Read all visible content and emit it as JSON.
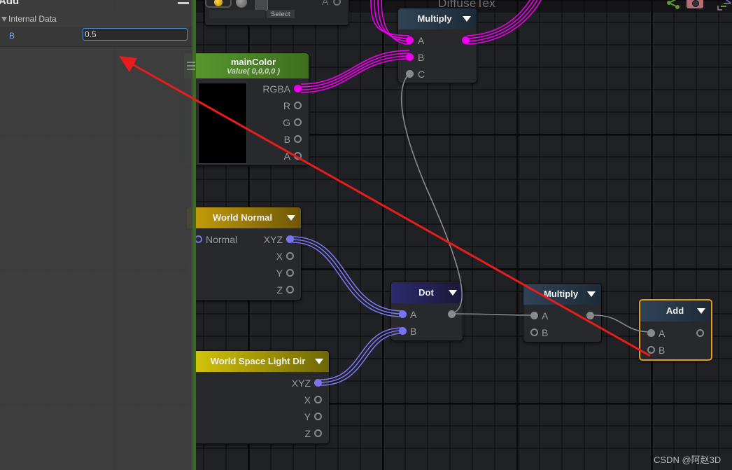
{
  "graph": {
    "title": "DiffuseTex",
    "watermark": "CSDN @阿赵3D",
    "toolbar_icons": [
      "share-icon",
      "camera-icon",
      "graph-layout-icon"
    ]
  },
  "colors": {
    "canvas_bg": "#202124",
    "wire_color": "#ee00ee",
    "wire_vector": "#7b74f0",
    "wire_float": "#8a8a8c",
    "selection": "#e09b1e",
    "annotation_arrow": "#e81c1c",
    "panel_accent": "#3a6b21"
  },
  "panel": {
    "title": "Add",
    "section": "Internal Data",
    "property_label": "B",
    "property_value": "0.5"
  },
  "top_partial_node": {
    "select_label": "Select",
    "port_label": "A"
  },
  "nodes": {
    "multiply_top": {
      "title": "Multiply",
      "inputs": [
        "A",
        "B",
        "C"
      ]
    },
    "main_color": {
      "title": "mainColor",
      "subtitle": "Value( 0,0,0,0 )",
      "outputs": [
        "RGBA",
        "R",
        "G",
        "B",
        "A"
      ]
    },
    "world_normal": {
      "title": "World Normal",
      "input": "Normal",
      "outputs": [
        "XYZ",
        "X",
        "Y",
        "Z"
      ]
    },
    "light_dir": {
      "title": "World Space Light Dir",
      "outputs": [
        "XYZ",
        "X",
        "Y",
        "Z"
      ]
    },
    "dot": {
      "title": "Dot",
      "inputs": [
        "A",
        "B"
      ]
    },
    "multiply_bottom": {
      "title": "Multiply",
      "inputs": [
        "A",
        "B"
      ]
    },
    "add": {
      "title": "Add",
      "inputs": [
        "A",
        "B"
      ]
    }
  }
}
